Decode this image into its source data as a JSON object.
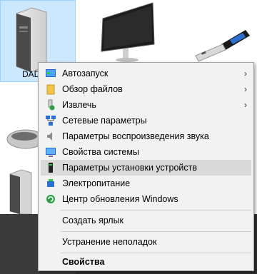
{
  "devices": {
    "pc_label": "DAD"
  },
  "context_menu": {
    "items": [
      {
        "label": "Автозапуск",
        "icon": "autoplay-icon",
        "submenu": true
      },
      {
        "label": "Обзор файлов",
        "icon": "folder-icon",
        "submenu": true
      },
      {
        "label": "Извлечь",
        "icon": "eject-usb-icon",
        "submenu": true
      },
      {
        "label": "Сетевые параметры",
        "icon": "network-icon",
        "submenu": false
      },
      {
        "label": "Параметры воспроизведения звука",
        "icon": "speaker-icon",
        "submenu": false
      },
      {
        "label": "Свойства системы",
        "icon": "system-monitor-icon",
        "submenu": false
      },
      {
        "label": "Параметры установки устройств",
        "icon": "device-install-icon",
        "submenu": false,
        "highlighted": true
      },
      {
        "label": "Электропитание",
        "icon": "power-icon",
        "submenu": false
      },
      {
        "label": "Центр обновления Windows",
        "icon": "windows-update-icon",
        "submenu": false
      },
      {
        "label": "Создать ярлык",
        "submenu": false
      },
      {
        "label": "Устранение неполадок",
        "submenu": false
      },
      {
        "label": "Свойства",
        "submenu": false,
        "bold": true
      }
    ],
    "submenu_arrow": "›"
  },
  "colors": {
    "selection_tile": "#cce8ff",
    "menu_background": "#f2f2f2",
    "menu_hover": "#dadada"
  }
}
